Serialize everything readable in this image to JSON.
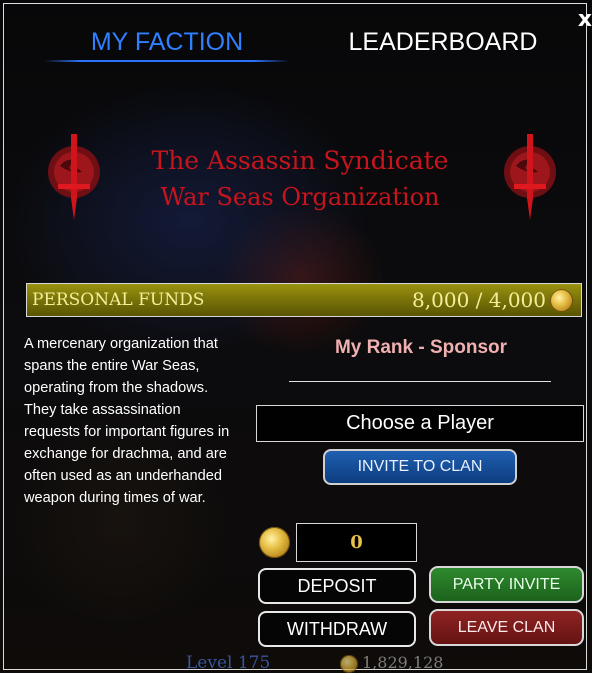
{
  "tabs": [
    {
      "label": "MY FACTION",
      "active": true
    },
    {
      "label": "LEADERBOARD",
      "active": false
    }
  ],
  "close_label": "x",
  "faction": {
    "name_line1": "The Assassin Syndicate",
    "name_line2": "War Seas Organization",
    "emblem_icon": "sword-emblem-icon",
    "description": "A mercenary organization that spans the entire War Seas, operating from the shadows. They take assassination requests for important figures in exchange for drachma, and are often used as an underhanded weapon during times of war."
  },
  "funds": {
    "label": "PERSONAL FUNDS",
    "value": "8,000 / 4,000",
    "icon": "coin-icon"
  },
  "rank": {
    "text": "My Rank - Sponsor"
  },
  "player_select": {
    "value": "Choose a Player"
  },
  "buttons": {
    "invite": "INVITE TO CLAN",
    "deposit": "DEPOSIT",
    "withdraw": "WITHDRAW",
    "party_invite": "PARTY INVITE",
    "leave_clan": "LEAVE CLAN"
  },
  "amount": {
    "value": "0"
  },
  "background_hud": {
    "level": "Level 175",
    "gold": "1,829,128"
  },
  "colors": {
    "tab_active": "#2f7fff",
    "faction_title": "#c7141d",
    "funds_bar": "#7c7509",
    "invite_button": "#1f5fb0",
    "party_button": "#2e8a2e",
    "leave_button": "#8f2323"
  }
}
